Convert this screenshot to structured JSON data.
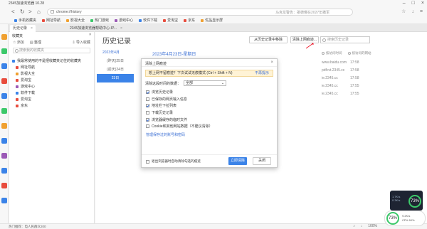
{
  "window": {
    "title": "2345加速浏览器 10.28"
  },
  "nav": {
    "url": "chrome://history",
    "hint": "马克龙警告：歌德俄在2027年撤军"
  },
  "bookmarks": [
    {
      "label": "手机收藏夹",
      "color": "#3b83e8"
    },
    {
      "label": "网址导航",
      "color": "#e84c3d"
    },
    {
      "label": "影视大全",
      "color": "#f0a030"
    },
    {
      "label": "热门游戏",
      "color": "#3cc86a"
    },
    {
      "label": "游戏中心",
      "color": "#9b59b6"
    },
    {
      "label": "软件下载",
      "color": "#3b83e8"
    },
    {
      "label": "爱淘宝",
      "color": "#e84c3d"
    },
    {
      "label": "京东",
      "color": "#e84c3d"
    },
    {
      "label": "优品显示屏",
      "color": "#f0a030"
    }
  ],
  "tabs": [
    {
      "label": "历史记录",
      "active": true
    },
    {
      "label": "2345加速浏览器帮助中心-IP...",
      "active": false
    }
  ],
  "favorites": {
    "title": "收藏夹",
    "add": "添加",
    "organize": "整理",
    "import": "导入收藏",
    "search_placeholder": "搜索我的收藏夹",
    "root": "我最常使用的不是把收藏夹记住的收藏夹",
    "items": [
      {
        "label": "网址导航",
        "color": "#e84c3d"
      },
      {
        "label": "影视大全",
        "color": "#f0a030"
      },
      {
        "label": "爱淘宝",
        "color": "#e84c3d"
      },
      {
        "label": "游戏中心",
        "color": "#9b59b6"
      },
      {
        "label": "软件下载",
        "color": "#3b83e8"
      },
      {
        "label": "爱淘宝",
        "color": "#e84c3d"
      },
      {
        "label": "京东",
        "color": "#e84c3d"
      }
    ]
  },
  "history": {
    "title": "历史记录",
    "btn_remove": "从历史记录中移除",
    "btn_clear": "清除上网痕迹...",
    "search_placeholder": "搜索历史记录",
    "dates": [
      "2023年4月",
      "(昨天)25日",
      "(前天)24日",
      "23日"
    ],
    "day_heading": "2023年4月23日-星期日",
    "view_time": "按访问时间",
    "view_site": "按访问的网站",
    "rows": [
      {
        "site": "www.baidu.com",
        "time": "17:58"
      },
      {
        "site": "pdfcvt.2345.cc",
        "time": "17:58"
      },
      {
        "site": "ie.2345.cc",
        "time": "17:58"
      },
      {
        "site": "ie.2345.cc",
        "time": "17:55"
      },
      {
        "site": "ie.2345.cc",
        "time": "17:55"
      }
    ]
  },
  "dialog": {
    "title": "清除上网痕迹",
    "banner": "想上网不留痕迹？下次试试无痕模式 (Ctrl + Shift + N)",
    "banner_dismiss": "不再提示",
    "range_label": "清除这段时间的数据：",
    "range_value": "全部",
    "options": [
      {
        "label": "浏览历史记录",
        "checked": true
      },
      {
        "label": "已保存的网页输入信息",
        "checked": false
      },
      {
        "label": "地址栏下拉列表",
        "checked": true
      },
      {
        "label": "下载历史记录",
        "checked": false
      },
      {
        "label": "浏览器缓存的临时文件",
        "checked": true
      },
      {
        "label": "Cookie和其他网站数据（不建议清除）",
        "checked": false
      }
    ],
    "manage_link": "管理保存过的账号和密码",
    "exit_option": "退出浏览器时自动清除勾选的痕迹",
    "confirm": "立即清除",
    "cancel": "关闭"
  },
  "status": {
    "left": "热门推荐：电人民群众200",
    "right": [
      "100%"
    ]
  },
  "widgets": {
    "speed_pct": "73%",
    "speed_lines": [
      "1.7K/s",
      "0.3K/s"
    ],
    "ring_pct": "73%",
    "ring_lines": [
      "9.2K/s",
      "CPU 60%"
    ]
  }
}
